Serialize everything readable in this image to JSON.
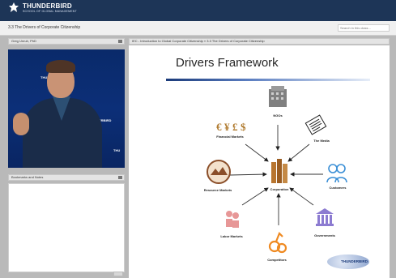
{
  "brand": {
    "name": "THUNDERBIRD",
    "tagline": "SCHOOL OF GLOBAL MANAGEMENT"
  },
  "course": {
    "title": "3.3 The Drivers of Corporate Citizenship"
  },
  "search": {
    "placeholder": "Search in this class..."
  },
  "left_panel": {
    "presenter": "Greg Unruh, PhD"
  },
  "right_panel": {
    "breadcrumb": "IEC - Introduction to Global Corporate Citizenship » 3.3 The Drivers of Corporate Citizenship"
  },
  "bookmarks": {
    "title": "Bookmarks and Notes"
  },
  "video": {
    "watermark_1": "THUNDERBIRD",
    "watermark_2": "THUNDERBIRD",
    "watermark_3": "THU"
  },
  "slide": {
    "title": "Drivers Framework",
    "center": "Corporation",
    "nodes": {
      "ngos": "NGOs",
      "financial": "Financial Markets",
      "media": "The Media",
      "resource": "Resource Markets",
      "customers": "Customers",
      "labor": "Labor Markets",
      "governments": "Governments",
      "competitors": "Competitors"
    },
    "logo": "THUNDERBIRD"
  }
}
